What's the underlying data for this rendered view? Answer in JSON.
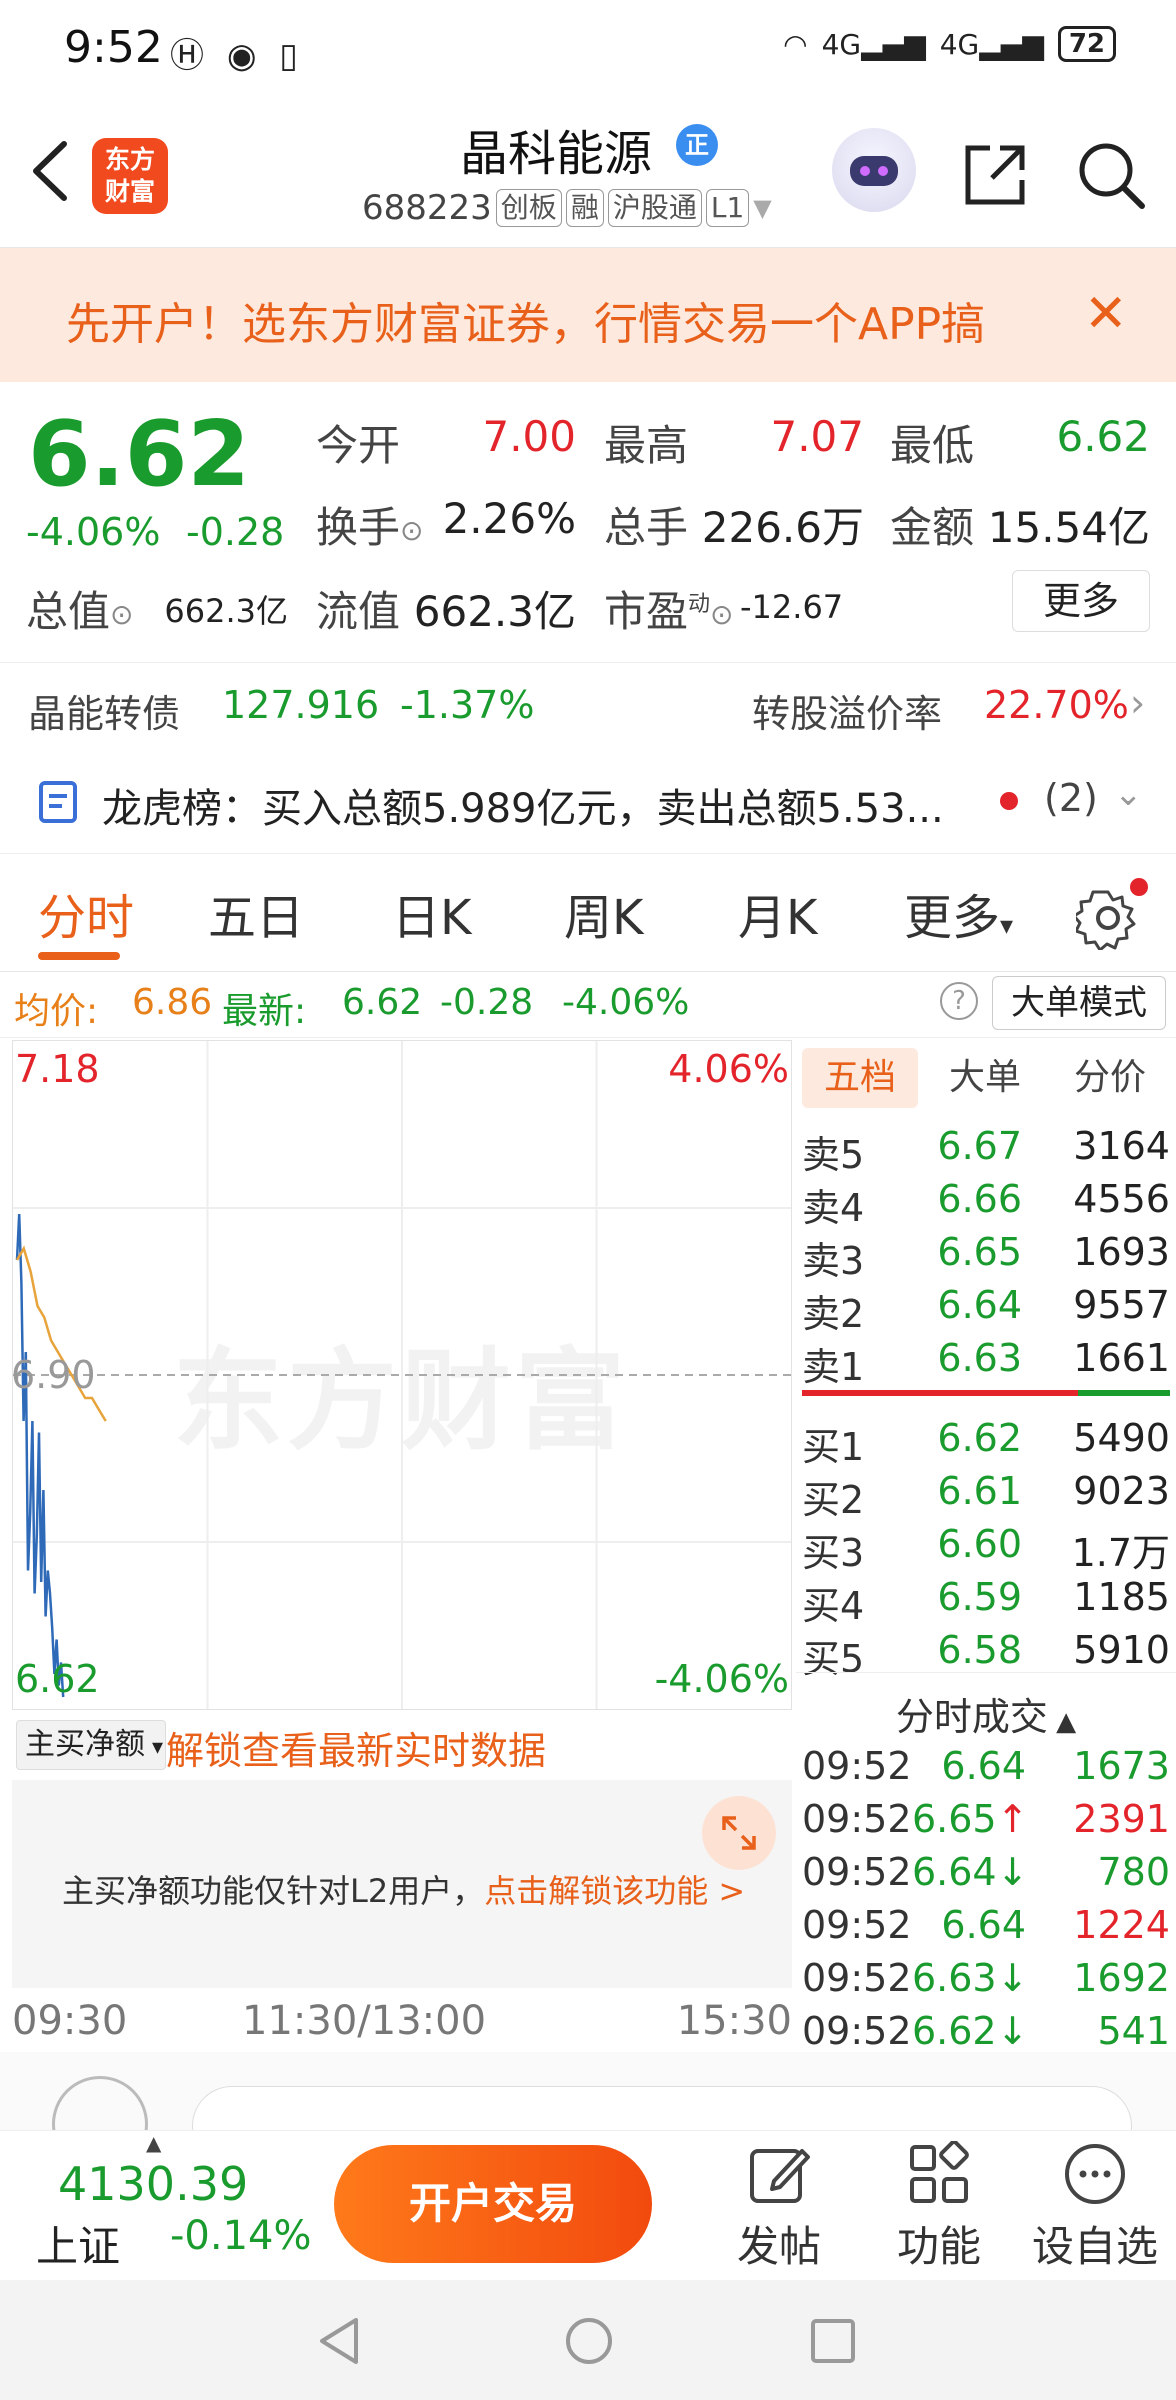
{
  "status": {
    "time": "9:52",
    "signal1": "4G",
    "signal2": "4G",
    "battery": "72"
  },
  "header": {
    "logo_line1": "东方",
    "logo_line2": "财富",
    "stock_name": "晶科能源",
    "badge": "正",
    "code": "688223",
    "tags": [
      "创板",
      "融",
      "沪股通",
      "L1"
    ]
  },
  "banner": {
    "text": "先开户！选东方财富证券，行情交易一个APP搞"
  },
  "quote": {
    "price": "6.62",
    "change_pct": "-4.06%",
    "change": "-0.28",
    "open_label": "今开",
    "open": "7.00",
    "high_label": "最高",
    "high": "7.07",
    "low_label": "最低",
    "low": "6.62",
    "turnover_label": "换手",
    "turnover": "2.26%",
    "volume_label": "总手",
    "volume": "226.6万",
    "amount_label": "金额",
    "amount": "15.54亿",
    "mktcap_label": "总值",
    "mktcap": "662.3亿",
    "float_label": "流值",
    "float": "662.3亿",
    "pe_label": "市盈",
    "pe_sup": "动",
    "pe": "-12.67",
    "more": "更多"
  },
  "bond": {
    "name": "晶能转债",
    "price": "127.916",
    "change": "-1.37%",
    "premium_label": "转股溢价率",
    "premium": "22.70%"
  },
  "lhb": {
    "text": "龙虎榜：买入总额5.989亿元，卖出总额5.53...",
    "count": "(2)"
  },
  "tabs": [
    "分时",
    "五日",
    "日K",
    "周K",
    "月K",
    "更多"
  ],
  "avgrow": {
    "avg_label": "均价:",
    "avg": "6.86",
    "last_label": "最新:",
    "last": "6.62",
    "chg": "-0.28",
    "pct": "-4.06%",
    "mode": "大单模式"
  },
  "chart_data": {
    "type": "line",
    "y_top": "7.18",
    "y_mid": "6.90",
    "y_bottom": "6.62",
    "pct_top": "4.06%",
    "pct_bottom": "-4.06%",
    "ylim": [
      6.62,
      7.18
    ],
    "x_labels": [
      "09:30",
      "11:30/13:00",
      "15:30"
    ],
    "watermark": "东方财富",
    "series": [
      {
        "color": "#2e6ab8",
        "values": [
          7.0,
          7.04,
          6.98,
          6.86,
          6.92,
          6.73,
          6.78,
          6.86,
          6.71,
          6.76,
          6.85,
          6.72,
          6.8,
          6.69,
          6.73,
          6.71,
          6.68,
          6.64,
          6.67,
          6.63,
          6.65,
          6.62
        ]
      },
      {
        "color": "#e8a33a",
        "values": [
          7.0,
          7.01,
          6.99,
          6.96,
          6.95,
          6.93,
          6.92,
          6.91,
          6.9,
          6.89,
          6.88,
          6.88,
          6.87,
          6.86
        ]
      }
    ]
  },
  "net": {
    "select": "主买净额",
    "unlock": "解锁查看最新实时数据",
    "l2_text": "主买净额功能仅针对L2用户，",
    "l2_link": "点击解锁该功能 >"
  },
  "orderbook": {
    "tabs": [
      "五档",
      "大单",
      "分价"
    ],
    "sells": [
      {
        "label": "卖5",
        "price": "6.67",
        "vol": "3164"
      },
      {
        "label": "卖4",
        "price": "6.66",
        "vol": "4556"
      },
      {
        "label": "卖3",
        "price": "6.65",
        "vol": "1693"
      },
      {
        "label": "卖2",
        "price": "6.64",
        "vol": "9557"
      },
      {
        "label": "卖1",
        "price": "6.63",
        "vol": "1661"
      }
    ],
    "buys": [
      {
        "label": "买1",
        "price": "6.62",
        "vol": "5490"
      },
      {
        "label": "买2",
        "price": "6.61",
        "vol": "9023"
      },
      {
        "label": "买3",
        "price": "6.60",
        "vol": "1.7万"
      },
      {
        "label": "买4",
        "price": "6.59",
        "vol": "1185"
      },
      {
        "label": "买5",
        "price": "6.58",
        "vol": "5910"
      }
    ],
    "ticks_title": "分时成交",
    "ticks": [
      {
        "time": "09:52",
        "price": "6.64",
        "vol": "1673",
        "vcolor": "#1a9b2e",
        "arrow": ""
      },
      {
        "time": "09:52",
        "price": "6.65",
        "vol": "2391",
        "vcolor": "#e3242b",
        "arrow": "↑"
      },
      {
        "time": "09:52",
        "price": "6.64",
        "vol": "780",
        "vcolor": "#1a9b2e",
        "arrow": "↓"
      },
      {
        "time": "09:52",
        "price": "6.64",
        "vol": "1224",
        "vcolor": "#e3242b",
        "arrow": ""
      },
      {
        "time": "09:52",
        "price": "6.63",
        "vol": "1692",
        "vcolor": "#1a9b2e",
        "arrow": "↓"
      },
      {
        "time": "09:52",
        "price": "6.62",
        "vol": "541",
        "vcolor": "#1a9b2e",
        "arrow": "↓"
      }
    ]
  },
  "bottom": {
    "index_value": "4130.39",
    "index_name": "上证",
    "index_change": "-0.14%",
    "open_trade": "开户交易",
    "post": "发帖",
    "func": "功能",
    "watch": "设自选"
  },
  "colors": {
    "up": "#e3242b",
    "down": "#1a9b2e",
    "accent": "#e8601a"
  }
}
